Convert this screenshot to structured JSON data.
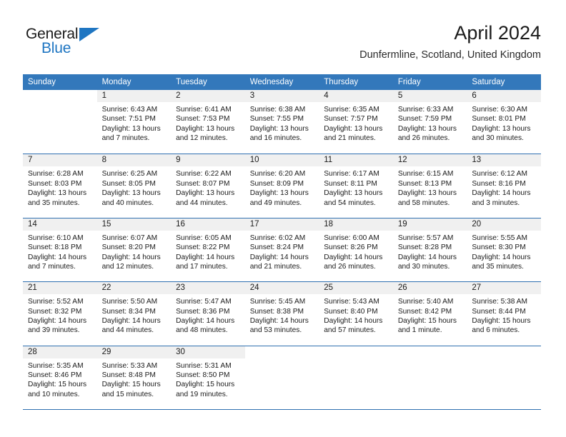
{
  "brand": {
    "name_part1": "General",
    "name_part2": "Blue",
    "accent_color": "#1f76c2"
  },
  "header": {
    "title": "April 2024",
    "subtitle": "Dunfermline, Scotland, United Kingdom"
  },
  "calendar": {
    "header_color": "#3378bb",
    "weekday_headers": [
      "Sunday",
      "Monday",
      "Tuesday",
      "Wednesday",
      "Thursday",
      "Friday",
      "Saturday"
    ],
    "weeks": [
      [
        {
          "day": "",
          "sunrise": "",
          "sunset": "",
          "daylight": ""
        },
        {
          "day": "1",
          "sunrise": "Sunrise: 6:43 AM",
          "sunset": "Sunset: 7:51 PM",
          "daylight": "Daylight: 13 hours and 7 minutes."
        },
        {
          "day": "2",
          "sunrise": "Sunrise: 6:41 AM",
          "sunset": "Sunset: 7:53 PM",
          "daylight": "Daylight: 13 hours and 12 minutes."
        },
        {
          "day": "3",
          "sunrise": "Sunrise: 6:38 AM",
          "sunset": "Sunset: 7:55 PM",
          "daylight": "Daylight: 13 hours and 16 minutes."
        },
        {
          "day": "4",
          "sunrise": "Sunrise: 6:35 AM",
          "sunset": "Sunset: 7:57 PM",
          "daylight": "Daylight: 13 hours and 21 minutes."
        },
        {
          "day": "5",
          "sunrise": "Sunrise: 6:33 AM",
          "sunset": "Sunset: 7:59 PM",
          "daylight": "Daylight: 13 hours and 26 minutes."
        },
        {
          "day": "6",
          "sunrise": "Sunrise: 6:30 AM",
          "sunset": "Sunset: 8:01 PM",
          "daylight": "Daylight: 13 hours and 30 minutes."
        }
      ],
      [
        {
          "day": "7",
          "sunrise": "Sunrise: 6:28 AM",
          "sunset": "Sunset: 8:03 PM",
          "daylight": "Daylight: 13 hours and 35 minutes."
        },
        {
          "day": "8",
          "sunrise": "Sunrise: 6:25 AM",
          "sunset": "Sunset: 8:05 PM",
          "daylight": "Daylight: 13 hours and 40 minutes."
        },
        {
          "day": "9",
          "sunrise": "Sunrise: 6:22 AM",
          "sunset": "Sunset: 8:07 PM",
          "daylight": "Daylight: 13 hours and 44 minutes."
        },
        {
          "day": "10",
          "sunrise": "Sunrise: 6:20 AM",
          "sunset": "Sunset: 8:09 PM",
          "daylight": "Daylight: 13 hours and 49 minutes."
        },
        {
          "day": "11",
          "sunrise": "Sunrise: 6:17 AM",
          "sunset": "Sunset: 8:11 PM",
          "daylight": "Daylight: 13 hours and 54 minutes."
        },
        {
          "day": "12",
          "sunrise": "Sunrise: 6:15 AM",
          "sunset": "Sunset: 8:13 PM",
          "daylight": "Daylight: 13 hours and 58 minutes."
        },
        {
          "day": "13",
          "sunrise": "Sunrise: 6:12 AM",
          "sunset": "Sunset: 8:16 PM",
          "daylight": "Daylight: 14 hours and 3 minutes."
        }
      ],
      [
        {
          "day": "14",
          "sunrise": "Sunrise: 6:10 AM",
          "sunset": "Sunset: 8:18 PM",
          "daylight": "Daylight: 14 hours and 7 minutes."
        },
        {
          "day": "15",
          "sunrise": "Sunrise: 6:07 AM",
          "sunset": "Sunset: 8:20 PM",
          "daylight": "Daylight: 14 hours and 12 minutes."
        },
        {
          "day": "16",
          "sunrise": "Sunrise: 6:05 AM",
          "sunset": "Sunset: 8:22 PM",
          "daylight": "Daylight: 14 hours and 17 minutes."
        },
        {
          "day": "17",
          "sunrise": "Sunrise: 6:02 AM",
          "sunset": "Sunset: 8:24 PM",
          "daylight": "Daylight: 14 hours and 21 minutes."
        },
        {
          "day": "18",
          "sunrise": "Sunrise: 6:00 AM",
          "sunset": "Sunset: 8:26 PM",
          "daylight": "Daylight: 14 hours and 26 minutes."
        },
        {
          "day": "19",
          "sunrise": "Sunrise: 5:57 AM",
          "sunset": "Sunset: 8:28 PM",
          "daylight": "Daylight: 14 hours and 30 minutes."
        },
        {
          "day": "20",
          "sunrise": "Sunrise: 5:55 AM",
          "sunset": "Sunset: 8:30 PM",
          "daylight": "Daylight: 14 hours and 35 minutes."
        }
      ],
      [
        {
          "day": "21",
          "sunrise": "Sunrise: 5:52 AM",
          "sunset": "Sunset: 8:32 PM",
          "daylight": "Daylight: 14 hours and 39 minutes."
        },
        {
          "day": "22",
          "sunrise": "Sunrise: 5:50 AM",
          "sunset": "Sunset: 8:34 PM",
          "daylight": "Daylight: 14 hours and 44 minutes."
        },
        {
          "day": "23",
          "sunrise": "Sunrise: 5:47 AM",
          "sunset": "Sunset: 8:36 PM",
          "daylight": "Daylight: 14 hours and 48 minutes."
        },
        {
          "day": "24",
          "sunrise": "Sunrise: 5:45 AM",
          "sunset": "Sunset: 8:38 PM",
          "daylight": "Daylight: 14 hours and 53 minutes."
        },
        {
          "day": "25",
          "sunrise": "Sunrise: 5:43 AM",
          "sunset": "Sunset: 8:40 PM",
          "daylight": "Daylight: 14 hours and 57 minutes."
        },
        {
          "day": "26",
          "sunrise": "Sunrise: 5:40 AM",
          "sunset": "Sunset: 8:42 PM",
          "daylight": "Daylight: 15 hours and 1 minute."
        },
        {
          "day": "27",
          "sunrise": "Sunrise: 5:38 AM",
          "sunset": "Sunset: 8:44 PM",
          "daylight": "Daylight: 15 hours and 6 minutes."
        }
      ],
      [
        {
          "day": "28",
          "sunrise": "Sunrise: 5:35 AM",
          "sunset": "Sunset: 8:46 PM",
          "daylight": "Daylight: 15 hours and 10 minutes."
        },
        {
          "day": "29",
          "sunrise": "Sunrise: 5:33 AM",
          "sunset": "Sunset: 8:48 PM",
          "daylight": "Daylight: 15 hours and 15 minutes."
        },
        {
          "day": "30",
          "sunrise": "Sunrise: 5:31 AM",
          "sunset": "Sunset: 8:50 PM",
          "daylight": "Daylight: 15 hours and 19 minutes."
        },
        {
          "day": "",
          "sunrise": "",
          "sunset": "",
          "daylight": ""
        },
        {
          "day": "",
          "sunrise": "",
          "sunset": "",
          "daylight": ""
        },
        {
          "day": "",
          "sunrise": "",
          "sunset": "",
          "daylight": ""
        },
        {
          "day": "",
          "sunrise": "",
          "sunset": "",
          "daylight": ""
        }
      ]
    ]
  }
}
